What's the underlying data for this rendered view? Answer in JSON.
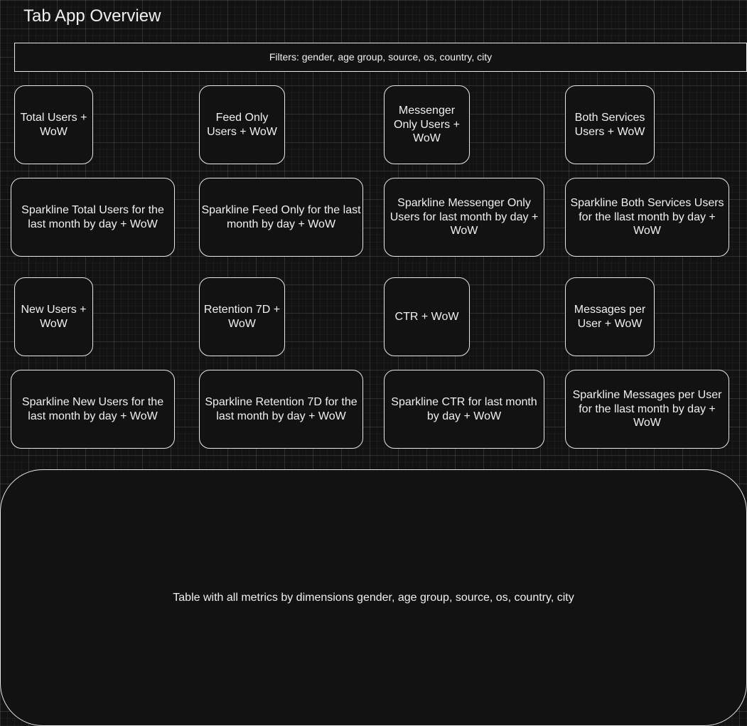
{
  "title": "Tab App Overview",
  "filters_label": "Filters: gender, age group, source, os, country, city",
  "kpis": [
    {
      "label": "Total Users + WoW"
    },
    {
      "label": "Feed Only Users + WoW"
    },
    {
      "label": "Messenger Only Users + WoW"
    },
    {
      "label": "Both Services Users + WoW"
    },
    {
      "label": "New Users + WoW"
    },
    {
      "label": "Retention 7D + WoW"
    },
    {
      "label": "CTR + WoW"
    },
    {
      "label": "Messages per User + WoW"
    }
  ],
  "sparklines": [
    {
      "label": "Sparkline Total Users for the last month by day + WoW"
    },
    {
      "label": "Sparkline Feed Only for the last month by day + WoW"
    },
    {
      "label": "Sparkline Messenger Only Users for last month by day + WoW"
    },
    {
      "label": "Sparkline Both Services Users for the llast month by day + WoW"
    },
    {
      "label": "Sparkline New Users for the last month by day + WoW"
    },
    {
      "label": "Sparkline Retention 7D for the last month by day + WoW"
    },
    {
      "label": "Sparkline CTR for last month by day + WoW"
    },
    {
      "label": "Sparkline Messages per User for the llast month by day + WoW"
    }
  ],
  "table_label": "Table with all metrics by dimensions gender, age group, source, os, country, city",
  "colors": {
    "background": "#121212",
    "stroke": "#e8e8e8",
    "text": "#f0f0f0"
  }
}
